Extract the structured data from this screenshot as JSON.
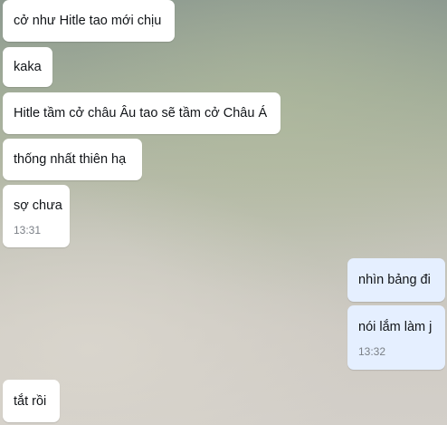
{
  "messages": [
    {
      "direction": "incoming",
      "text": "cở như Hitle tao mới chịu"
    },
    {
      "direction": "incoming",
      "text": "kaka"
    },
    {
      "direction": "incoming",
      "text": "Hitle tầm cở châu Âu tao sẽ tầm cở Châu Á"
    },
    {
      "direction": "incoming",
      "text": "thống nhất thiên hạ"
    },
    {
      "direction": "incoming",
      "text": "sợ chưa",
      "time": "13:31"
    },
    {
      "direction": "outgoing",
      "text": "nhìn bảng đi"
    },
    {
      "direction": "outgoing",
      "text": "nói lắm làm j",
      "time": "13:32"
    },
    {
      "direction": "incoming",
      "text": "tắt rồi"
    }
  ],
  "colors": {
    "incoming_bubble": "#ffffff",
    "outgoing_bubble": "#e5efff",
    "timestamp": "#7a7f86"
  }
}
